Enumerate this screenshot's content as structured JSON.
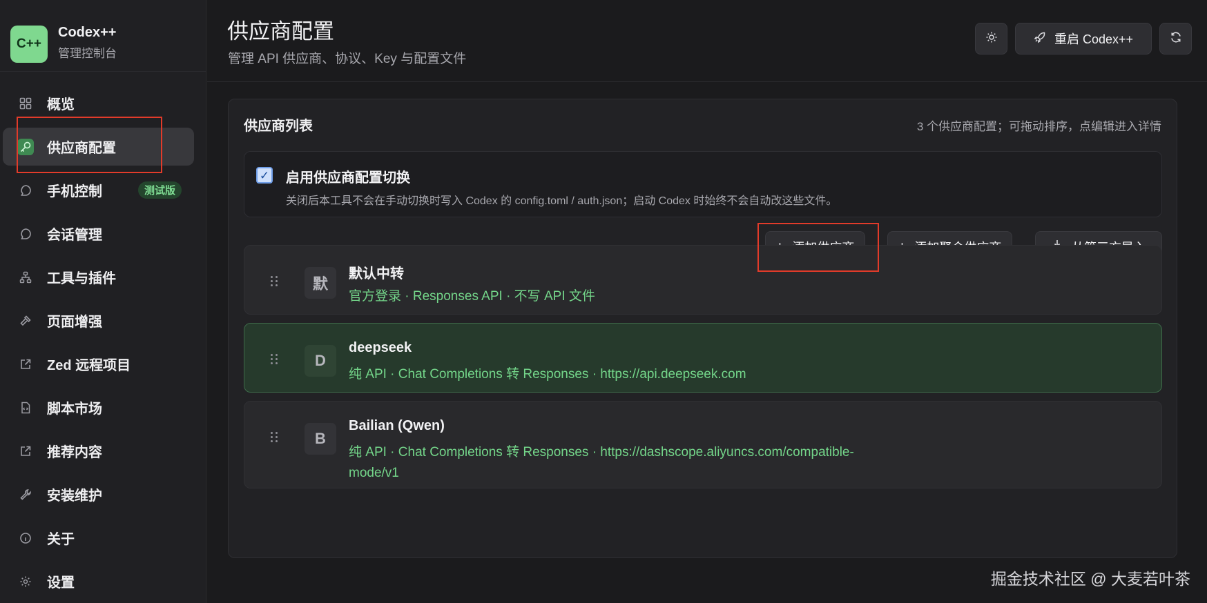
{
  "app": {
    "logo": "C++",
    "name": "Codex++",
    "subtitle": "管理控制台"
  },
  "sidebar": {
    "items": [
      {
        "label": "概览",
        "icon": "grid-icon"
      },
      {
        "label": "供应商配置",
        "icon": "key-icon",
        "active": true
      },
      {
        "label": "手机控制",
        "icon": "chat-bubble-icon",
        "badge": "测试版"
      },
      {
        "label": "会话管理",
        "icon": "chat-bubble-icon"
      },
      {
        "label": "工具与插件",
        "icon": "hierarchy-icon"
      },
      {
        "label": "页面增强",
        "icon": "hammer-icon"
      },
      {
        "label": "Zed 远程项目",
        "icon": "external-link-icon"
      },
      {
        "label": "脚本市场",
        "icon": "script-file-icon"
      },
      {
        "label": "推荐内容",
        "icon": "external-link-icon"
      },
      {
        "label": "安装维护",
        "icon": "wrench-icon"
      },
      {
        "label": "关于",
        "icon": "info-icon"
      },
      {
        "label": "设置",
        "icon": "gear-icon"
      }
    ]
  },
  "header": {
    "title": "供应商配置",
    "subtitle": "管理 API 供应商、协议、Key 与配置文件",
    "restart_label": "重启 Codex++"
  },
  "provider_panel": {
    "title": "供应商列表",
    "meta": "3 个供应商配置；可拖动排序，点编辑进入详情",
    "toggle": {
      "checked": true,
      "title": "启用供应商配置切换",
      "description": "关闭后本工具不会在手动切换时写入 Codex 的 config.toml / auth.json；启动 Codex 时始终不会自动改这些文件。"
    },
    "actions": {
      "add": "添加供应商",
      "add_aggregate": "添加聚合供应商",
      "import": "从第三方导入"
    },
    "providers": [
      {
        "avatar": "默",
        "name": "默认中转",
        "desc": "官方登录 · Responses API · 不写 API 文件",
        "selected": false
      },
      {
        "avatar": "D",
        "name": "deepseek",
        "desc": "纯 API · Chat Completions 转 Responses · https://api.deepseek.com",
        "selected": true
      },
      {
        "avatar": "B",
        "name": "Bailian (Qwen)",
        "desc": "纯 API · Chat Completions 转 Responses · https://dashscope.aliyuncs.com/compatible-mode/v1",
        "selected": false
      }
    ]
  },
  "watermark": "掘金技术社区 @ 大麦若叶茶",
  "colors": {
    "accent_green": "#74d68a",
    "highlight_red": "#e23b2a",
    "logo_bg": "#7fd88f"
  }
}
